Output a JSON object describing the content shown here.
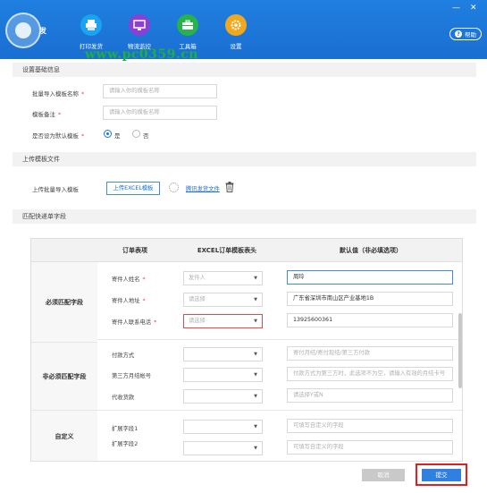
{
  "app": {
    "logo_text": "发",
    "watermark": "www.pc0359.cn"
  },
  "nav": [
    {
      "label": "打印发货",
      "icon": "print-icon",
      "color": "#1aa3f0"
    },
    {
      "label": "物流监控",
      "icon": "monitor-icon",
      "color": "#8a3fd6"
    },
    {
      "label": "工具箱",
      "icon": "toolbox-icon",
      "color": "#27b24a"
    },
    {
      "label": "设置",
      "icon": "gear-icon",
      "color": "#f2a81d"
    }
  ],
  "window": {
    "minimize": "—",
    "close": "✕",
    "help": "帮助"
  },
  "basic": {
    "section_title": "设置基础信息",
    "name_label": "批量导入模板名称",
    "name_placeholder": "请输入你的模板名称",
    "note_label": "模板备注",
    "note_placeholder": "请输入你的模板名称",
    "default_label": "是否设为默认模板",
    "yes": "是",
    "no": "否",
    "default_value": "是"
  },
  "upload": {
    "section_title": "上传模板文件",
    "label": "上传批量导入模板",
    "button": "上传EXCEL模板",
    "file_link": "腾讯发货文件"
  },
  "mapping": {
    "section_title": "匹配快递单字段",
    "headers": [
      "订单表项",
      "EXCEL订单模板表头",
      "默认值（非必填选项）"
    ],
    "groups": [
      {
        "name": "必须匹配字段",
        "rows": [
          {
            "label": "寄件人姓名",
            "required": true,
            "select": "发件人",
            "default": "周玲",
            "filled": true
          },
          {
            "label": "寄件人地址",
            "required": true,
            "select": "请选择",
            "default": "广东省深圳市南山区产业基地1B",
            "filled": true
          },
          {
            "label": "寄件人联系电话",
            "required": true,
            "select": "请选择",
            "default": "13925600361",
            "filled": true
          }
        ]
      },
      {
        "name": "非必须匹配字段",
        "rows": [
          {
            "label": "付款方式",
            "required": false,
            "select": "",
            "default": "寄付月结/寄付现结/第三方付款",
            "filled": false
          },
          {
            "label": "第三方月结帐号",
            "required": false,
            "select": "",
            "default": "付款方式为第三方时，此选项不为空，请输入有效的月结卡号",
            "filled": false
          },
          {
            "label": "代收货款",
            "required": false,
            "select": "",
            "default": "请选择Y或N",
            "filled": false
          }
        ]
      },
      {
        "name": "自定义",
        "rows": [
          {
            "label": "扩展字段1",
            "required": false,
            "select": "",
            "default": "可填写自定义的字段",
            "filled": false
          },
          {
            "label": "扩展字段2",
            "required": false,
            "select": "",
            "default": "可填写自定义的字段",
            "filled": false
          }
        ]
      }
    ]
  },
  "actions": {
    "cancel": "取消",
    "submit": "提交"
  },
  "colors": {
    "primary": "#1a6fd1",
    "highlight": "#e02020",
    "required": "#e24a4a"
  }
}
